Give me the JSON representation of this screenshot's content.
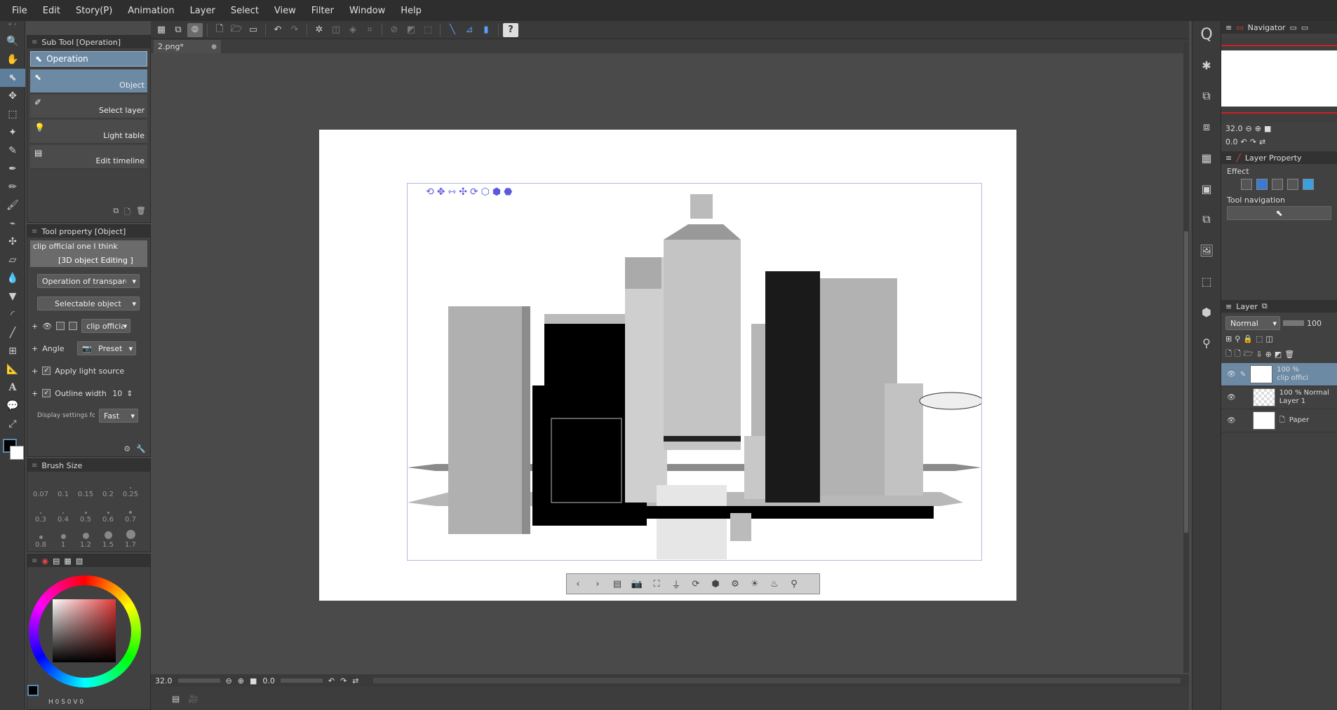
{
  "menu": [
    "File",
    "Edit",
    "Story(P)",
    "Animation",
    "Layer",
    "Select",
    "View",
    "Filter",
    "Window",
    "Help"
  ],
  "document": {
    "tab_label": "2.png*"
  },
  "subtool": {
    "title": "Sub Tool [Operation]",
    "group_label": "Operation",
    "items": [
      "Object",
      "Select layer",
      "Light table",
      "Edit timeline"
    ]
  },
  "toolprop": {
    "title": "Tool property [Object]",
    "preview_name": "clip official one I think",
    "preview_mode": "[3D object Editing ]",
    "transparent_op": "Operation of transparent part",
    "selectable": "Selectable object",
    "object_name": "clip official o",
    "angle_label": "Angle",
    "angle_value": "Preset",
    "light_label": "Apply light source",
    "outline_label": "Outline width",
    "outline_value": "10",
    "display_label": "Display settings for edi",
    "display_value": "Fast"
  },
  "brush": {
    "title": "Brush Size",
    "sizes": [
      "0.07",
      "0.1",
      "0.15",
      "0.2",
      "0.25",
      "0.3",
      "0.4",
      "0.5",
      "0.6",
      "0.7",
      "0.8",
      "1",
      "1.2",
      "1.5",
      "1.7"
    ]
  },
  "color": {
    "hsv": "H 0 S 0 V 0",
    "main": "#000000",
    "sub": "#ffffff"
  },
  "status": {
    "zoom": "32.0",
    "angle": "0.0"
  },
  "right": {
    "navigator_title": "Navigator",
    "nav_zoom": "32.0",
    "nav_angle": "0.0",
    "layer_property_title": "Layer Property",
    "effect_label": "Effect",
    "tool_nav_label": "Tool navigation",
    "layer_title": "Layer",
    "blend_mode": "Normal",
    "opacity": "100",
    "layers": [
      {
        "line1": "100 %",
        "line2": "clip offici"
      },
      {
        "line1": "100 % Normal",
        "line2": "Layer 1"
      },
      {
        "line1": "",
        "line2": "Paper"
      }
    ]
  }
}
